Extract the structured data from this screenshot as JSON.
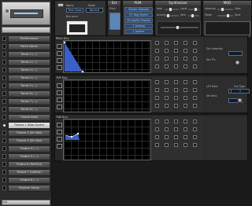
{
  "sidebar": {
    "programs": [
      "Performance",
      "Patch Name",
      "Tones 1 (...)",
      "Tones 2 (...)",
      "Tones 3 (...)",
      "Tones 4 (...)",
      "Tones 5 (...)",
      "Tones 6 (...)",
      "Tones 7 (...)",
      "Tones 8 (...)",
      "Timbre Bank",
      "Timbre 1 (Bap Synth)",
      "Timbre 2 (Str Bell)",
      "Timbre 3 (Str Bell)",
      "Timbre 4 (...)",
      "Timbre 5 (...)",
      "Timbre 6 (PerfCtrl)",
      "Timbre 7 (SoftStr)",
      "Timbre 8 (...)",
      "Rhythm Setup"
    ],
    "selected_index": 11,
    "footer": "Edit"
  },
  "panels": {
    "tone": {
      "title": "",
      "name_label": "Name",
      "mode_label": "Mode",
      "name_value": "Tone Base",
      "mode_value": "Normal",
      "extra_label": "Bus send"
    },
    "ext": {
      "title": "Ext"
    },
    "pgm": {
      "title": "PGM",
      "buttons": [
        "Stereo Sample",
        "27 Digi Synth",
        "28 Jupiter Sweep",
        "1 Analog",
        "1 Jupiter"
      ]
    },
    "synth": {
      "title": "Synthesizer",
      "labels": [
        "Velo",
        "Level",
        "Accent",
        "Velo"
      ]
    },
    "mod": {
      "title": "MOD",
      "labels": [
        "Intensity",
        "Gate",
        "Mode",
        "Tone"
      ]
    }
  },
  "rows": [
    {
      "title": "Pitch Env",
      "side_label_1": "Env Intensity",
      "side_label_2": "Key Trk"
    },
    {
      "title": "TVF Env",
      "side_label_1": "LFO Rate",
      "side_label_2": "Vel Sens"
    },
    {
      "title": "TVA Env"
    }
  ],
  "out_type": {
    "label": "Out Type",
    "value": "1"
  }
}
